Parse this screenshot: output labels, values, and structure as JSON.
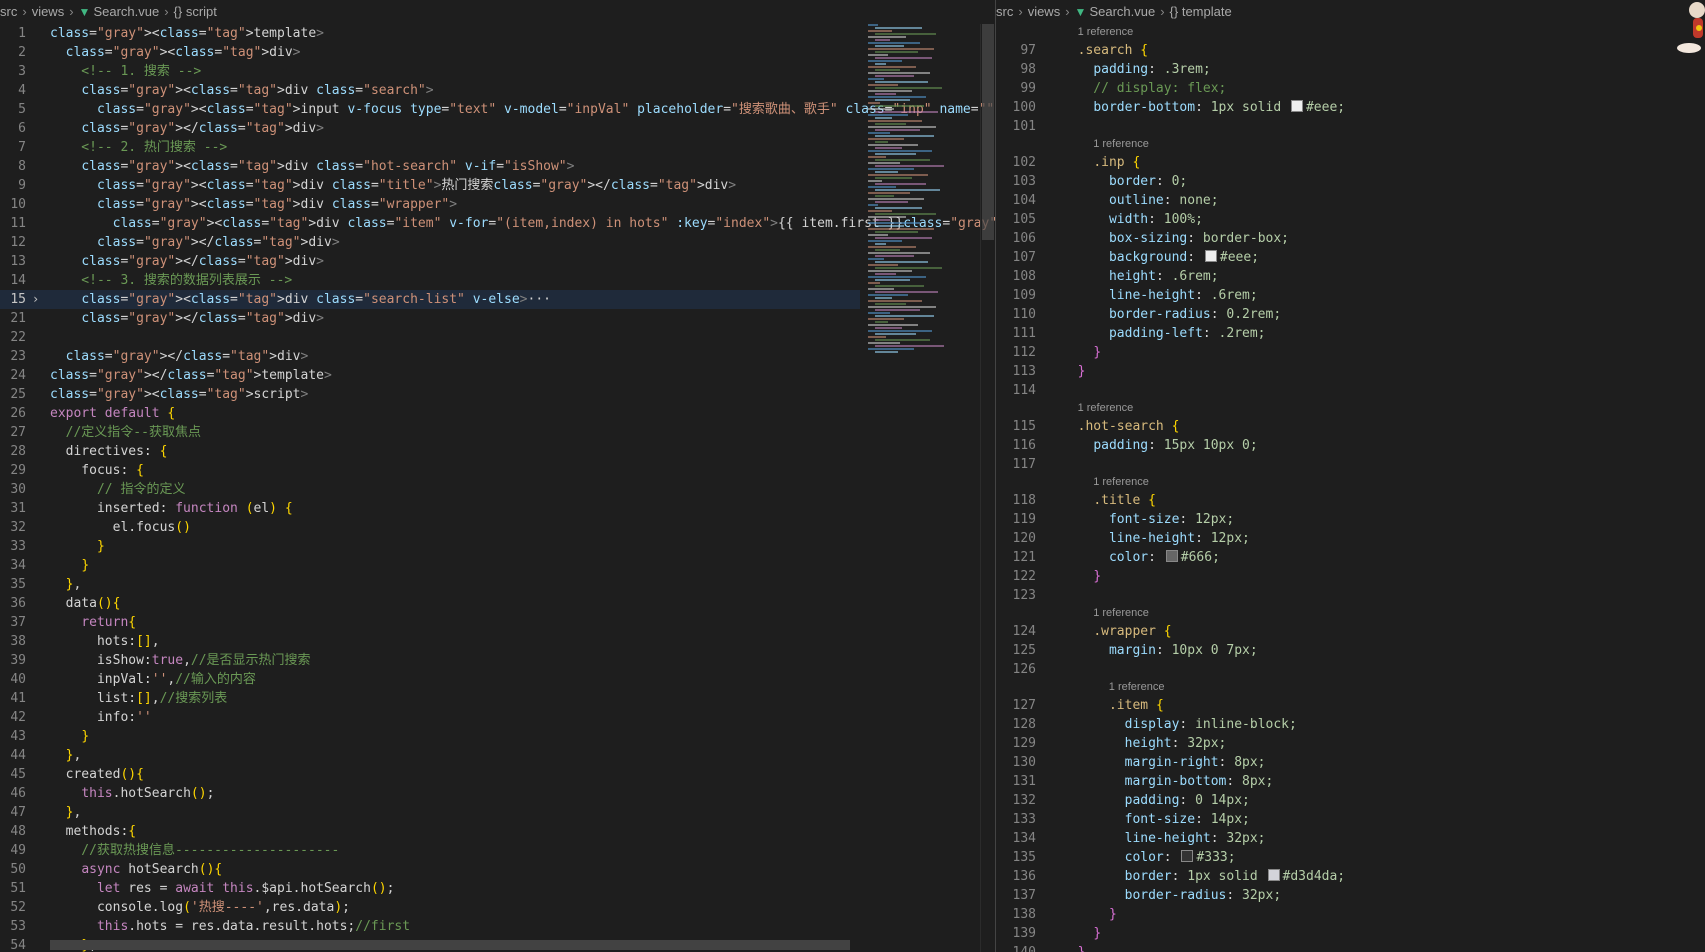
{
  "left_editor": {
    "breadcrumb": [
      "src",
      "views",
      "Search.vue",
      "{} script"
    ],
    "lines": [
      {
        "n": "1",
        "t": "<template>"
      },
      {
        "n": "2",
        "t": "  <div>"
      },
      {
        "n": "3",
        "t": "    <!-- 1. 搜索 -->"
      },
      {
        "n": "4",
        "t": "    <div class=\"search\">"
      },
      {
        "n": "5",
        "t": "      <input v-focus type=\"text\" v-model=\"inpVal\" placeholder=\"搜索歌曲、歌手\" class=\"inp\" name=\"\" id=\"\">"
      },
      {
        "n": "6",
        "t": "    </div>"
      },
      {
        "n": "7",
        "t": "    <!-- 2. 热门搜索 -->"
      },
      {
        "n": "8",
        "t": "    <div class=\"hot-search\" v-if=\"isShow\">"
      },
      {
        "n": "9",
        "t": "      <div class=\"title\">热门搜索</div>"
      },
      {
        "n": "10",
        "t": "      <div class=\"wrapper\">"
      },
      {
        "n": "11",
        "t": "        <div class=\"item\" v-for=\"(item,index) in hots\" :key=\"index\">{{ item.first }}</div>"
      },
      {
        "n": "12",
        "t": "      </div>"
      },
      {
        "n": "13",
        "t": "    </div>"
      },
      {
        "n": "14",
        "t": "    <!-- 3. 搜索的数据列表展示 -->"
      },
      {
        "n": "15",
        "t": "    <div class=\"search-list\" v-else>···"
      },
      {
        "n": "21",
        "t": "    </div>"
      },
      {
        "n": "22",
        "t": ""
      },
      {
        "n": "23",
        "t": "  </div>"
      },
      {
        "n": "24",
        "t": "</template>"
      },
      {
        "n": "25",
        "t": "<script>"
      },
      {
        "n": "26",
        "t": "export default {"
      },
      {
        "n": "27",
        "t": "  //定义指令--获取焦点"
      },
      {
        "n": "28",
        "t": "  directives: {"
      },
      {
        "n": "29",
        "t": "    focus: {"
      },
      {
        "n": "30",
        "t": "      // 指令的定义"
      },
      {
        "n": "31",
        "t": "      inserted: function (el) {"
      },
      {
        "n": "32",
        "t": "        el.focus()"
      },
      {
        "n": "33",
        "t": "      }"
      },
      {
        "n": "34",
        "t": "    }"
      },
      {
        "n": "35",
        "t": "  },"
      },
      {
        "n": "36",
        "t": "  data(){"
      },
      {
        "n": "37",
        "t": "    return{"
      },
      {
        "n": "38",
        "t": "      hots:[],"
      },
      {
        "n": "39",
        "t": "      isShow:true,//是否显示热门搜索"
      },
      {
        "n": "40",
        "t": "      inpVal:'',//输入的内容"
      },
      {
        "n": "41",
        "t": "      list:[],//搜索列表"
      },
      {
        "n": "42",
        "t": "      info:''"
      },
      {
        "n": "43",
        "t": "    }"
      },
      {
        "n": "44",
        "t": "  },"
      },
      {
        "n": "45",
        "t": "  created(){"
      },
      {
        "n": "46",
        "t": "    this.hotSearch();"
      },
      {
        "n": "47",
        "t": "  },"
      },
      {
        "n": "48",
        "t": "  methods:{"
      },
      {
        "n": "49",
        "t": "    //获取热搜信息---------------------"
      },
      {
        "n": "50",
        "t": "    async hotSearch(){"
      },
      {
        "n": "51",
        "t": "      let res = await this.$api.hotSearch();"
      },
      {
        "n": "52",
        "t": "      console.log('热搜----',res.data);"
      },
      {
        "n": "53",
        "t": "      this.hots = res.data.result.hots;//first"
      },
      {
        "n": "54",
        "t": "    },"
      }
    ]
  },
  "right_editor": {
    "breadcrumb": [
      "src",
      "views",
      "Search.vue",
      "{} template"
    ],
    "items": [
      {
        "ref": "1 reference",
        "indent": "  "
      },
      {
        "n": "97",
        "t": "  .search {"
      },
      {
        "n": "98",
        "t": "    padding: .3rem;"
      },
      {
        "n": "99",
        "t": "    // display: flex;"
      },
      {
        "n": "100",
        "t": "    border-bottom: 1px solid ",
        "swatch": "#eeeeee",
        "after": "#eee;"
      },
      {
        "n": "101",
        "t": ""
      },
      {
        "ref": "1 reference",
        "indent": "    "
      },
      {
        "n": "102",
        "t": "    .inp {"
      },
      {
        "n": "103",
        "t": "      border: 0;"
      },
      {
        "n": "104",
        "t": "      outline: none;"
      },
      {
        "n": "105",
        "t": "      width: 100%;"
      },
      {
        "n": "106",
        "t": "      box-sizing: border-box;"
      },
      {
        "n": "107",
        "t": "      background: ",
        "swatch": "#eeeeee",
        "after": "#eee;"
      },
      {
        "n": "108",
        "t": "      height: .6rem;"
      },
      {
        "n": "109",
        "t": "      line-height: .6rem;"
      },
      {
        "n": "110",
        "t": "      border-radius: 0.2rem;"
      },
      {
        "n": "111",
        "t": "      padding-left: .2rem;"
      },
      {
        "n": "112",
        "t": "    }"
      },
      {
        "n": "113",
        "t": "  }"
      },
      {
        "n": "114",
        "t": ""
      },
      {
        "ref": "1 reference",
        "indent": "  "
      },
      {
        "n": "115",
        "t": "  .hot-search {"
      },
      {
        "n": "116",
        "t": "    padding: 15px 10px 0;"
      },
      {
        "n": "117",
        "t": ""
      },
      {
        "ref": "1 reference",
        "indent": "    "
      },
      {
        "n": "118",
        "t": "    .title {"
      },
      {
        "n": "119",
        "t": "      font-size: 12px;"
      },
      {
        "n": "120",
        "t": "      line-height: 12px;"
      },
      {
        "n": "121",
        "t": "      color: ",
        "swatch": "#666666",
        "after": "#666;"
      },
      {
        "n": "122",
        "t": "    }"
      },
      {
        "n": "123",
        "t": ""
      },
      {
        "ref": "1 reference",
        "indent": "    "
      },
      {
        "n": "124",
        "t": "    .wrapper {"
      },
      {
        "n": "125",
        "t": "      margin: 10px 0 7px;"
      },
      {
        "n": "126",
        "t": ""
      },
      {
        "ref": "1 reference",
        "indent": "      "
      },
      {
        "n": "127",
        "t": "      .item {"
      },
      {
        "n": "128",
        "t": "        display: inline-block;"
      },
      {
        "n": "129",
        "t": "        height: 32px;"
      },
      {
        "n": "130",
        "t": "        margin-right: 8px;"
      },
      {
        "n": "131",
        "t": "        margin-bottom: 8px;"
      },
      {
        "n": "132",
        "t": "        padding: 0 14px;"
      },
      {
        "n": "133",
        "t": "        font-size: 14px;"
      },
      {
        "n": "134",
        "t": "        line-height: 32px;"
      },
      {
        "n": "135",
        "t": "        color: ",
        "swatch": "#333333",
        "after": "#333;"
      },
      {
        "n": "136",
        "t": "        border: 1px solid ",
        "swatch": "#d3d4da",
        "after": "#d3d4da;"
      },
      {
        "n": "137",
        "t": "        border-radius: 32px;"
      },
      {
        "n": "138",
        "t": "      }"
      },
      {
        "n": "139",
        "t": "    }"
      },
      {
        "n": "140",
        "t": "  }"
      }
    ]
  }
}
